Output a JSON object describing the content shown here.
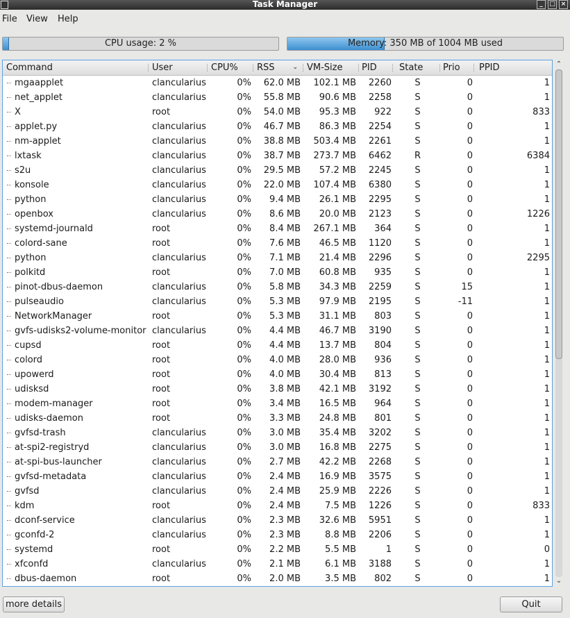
{
  "window": {
    "title": "Task Manager"
  },
  "menu": {
    "file": "File",
    "view": "View",
    "help": "Help"
  },
  "cpu_bar": {
    "label": "CPU usage: 2 %",
    "fraction": 0.02
  },
  "mem_bar": {
    "label": "Memory: 350 MB of 1004 MB used",
    "fraction": 0.349
  },
  "columns": [
    "Command",
    "User",
    "CPU%",
    "RSS",
    "VM-Size",
    "PID",
    "State",
    "Prio",
    "PPID"
  ],
  "sort_indicator": "chevron-down-icon",
  "processes": [
    [
      "mgaapplet",
      "clancularius",
      "0%",
      "62.0 MB",
      "102.1 MB",
      "2260",
      "S",
      "0",
      "1"
    ],
    [
      "net_applet",
      "clancularius",
      "0%",
      "55.8 MB",
      "90.6 MB",
      "2258",
      "S",
      "0",
      "1"
    ],
    [
      "X",
      "root",
      "0%",
      "54.0 MB",
      "95.3 MB",
      "922",
      "S",
      "0",
      "833"
    ],
    [
      "applet.py",
      "clancularius",
      "0%",
      "46.7 MB",
      "86.3 MB",
      "2254",
      "S",
      "0",
      "1"
    ],
    [
      "nm-applet",
      "clancularius",
      "0%",
      "38.8 MB",
      "503.4 MB",
      "2261",
      "S",
      "0",
      "1"
    ],
    [
      "lxtask",
      "clancularius",
      "0%",
      "38.7 MB",
      "273.7 MB",
      "6462",
      "R",
      "0",
      "6384"
    ],
    [
      "s2u",
      "clancularius",
      "0%",
      "29.5 MB",
      "57.2 MB",
      "2245",
      "S",
      "0",
      "1"
    ],
    [
      "konsole",
      "clancularius",
      "0%",
      "22.0 MB",
      "107.4 MB",
      "6380",
      "S",
      "0",
      "1"
    ],
    [
      "python",
      "clancularius",
      "0%",
      "9.4 MB",
      "26.1 MB",
      "2295",
      "S",
      "0",
      "1"
    ],
    [
      "openbox",
      "clancularius",
      "0%",
      "8.6 MB",
      "20.0 MB",
      "2123",
      "S",
      "0",
      "1226"
    ],
    [
      "systemd-journald",
      "root",
      "0%",
      "8.4 MB",
      "267.1 MB",
      "364",
      "S",
      "0",
      "1"
    ],
    [
      "colord-sane",
      "root",
      "0%",
      "7.6 MB",
      "46.5 MB",
      "1120",
      "S",
      "0",
      "1"
    ],
    [
      "python",
      "clancularius",
      "0%",
      "7.1 MB",
      "21.4 MB",
      "2296",
      "S",
      "0",
      "2295"
    ],
    [
      "polkitd",
      "root",
      "0%",
      "7.0 MB",
      "60.8 MB",
      "935",
      "S",
      "0",
      "1"
    ],
    [
      "pinot-dbus-daemon",
      "clancularius",
      "0%",
      "5.8 MB",
      "34.3 MB",
      "2259",
      "S",
      "15",
      "1"
    ],
    [
      "pulseaudio",
      "clancularius",
      "0%",
      "5.3 MB",
      "97.9 MB",
      "2195",
      "S",
      "-11",
      "1"
    ],
    [
      "NetworkManager",
      "root",
      "0%",
      "5.3 MB",
      "31.1 MB",
      "803",
      "S",
      "0",
      "1"
    ],
    [
      "gvfs-udisks2-volume-monitor",
      "clancularius",
      "0%",
      "4.4 MB",
      "46.7 MB",
      "3190",
      "S",
      "0",
      "1"
    ],
    [
      "cupsd",
      "root",
      "0%",
      "4.4 MB",
      "13.7 MB",
      "804",
      "S",
      "0",
      "1"
    ],
    [
      "colord",
      "root",
      "0%",
      "4.0 MB",
      "28.0 MB",
      "936",
      "S",
      "0",
      "1"
    ],
    [
      "upowerd",
      "root",
      "0%",
      "4.0 MB",
      "30.4 MB",
      "813",
      "S",
      "0",
      "1"
    ],
    [
      "udisksd",
      "root",
      "0%",
      "3.8 MB",
      "42.1 MB",
      "3192",
      "S",
      "0",
      "1"
    ],
    [
      "modem-manager",
      "root",
      "0%",
      "3.4 MB",
      "16.5 MB",
      "964",
      "S",
      "0",
      "1"
    ],
    [
      "udisks-daemon",
      "root",
      "0%",
      "3.3 MB",
      "24.8 MB",
      "801",
      "S",
      "0",
      "1"
    ],
    [
      "gvfsd-trash",
      "clancularius",
      "0%",
      "3.0 MB",
      "35.4 MB",
      "3202",
      "S",
      "0",
      "1"
    ],
    [
      "at-spi2-registryd",
      "clancularius",
      "0%",
      "3.0 MB",
      "16.8 MB",
      "2275",
      "S",
      "0",
      "1"
    ],
    [
      "at-spi-bus-launcher",
      "clancularius",
      "0%",
      "2.7 MB",
      "42.2 MB",
      "2268",
      "S",
      "0",
      "1"
    ],
    [
      "gvfsd-metadata",
      "clancularius",
      "0%",
      "2.4 MB",
      "16.9 MB",
      "3575",
      "S",
      "0",
      "1"
    ],
    [
      "gvfsd",
      "clancularius",
      "0%",
      "2.4 MB",
      "25.9 MB",
      "2226",
      "S",
      "0",
      "1"
    ],
    [
      "kdm",
      "root",
      "0%",
      "2.4 MB",
      "7.5 MB",
      "1226",
      "S",
      "0",
      "833"
    ],
    [
      "dconf-service",
      "clancularius",
      "0%",
      "2.3 MB",
      "32.6 MB",
      "5951",
      "S",
      "0",
      "1"
    ],
    [
      "gconfd-2",
      "clancularius",
      "0%",
      "2.3 MB",
      "8.8 MB",
      "2206",
      "S",
      "0",
      "1"
    ],
    [
      "systemd",
      "root",
      "0%",
      "2.2 MB",
      "5.5 MB",
      "1",
      "S",
      "0",
      "0"
    ],
    [
      "xfconfd",
      "clancularius",
      "0%",
      "2.1 MB",
      "6.1 MB",
      "3188",
      "S",
      "0",
      "1"
    ],
    [
      "dbus-daemon",
      "root",
      "0%",
      "2.0 MB",
      "3.5 MB",
      "802",
      "S",
      "0",
      "1"
    ]
  ],
  "scrollbar": {
    "position_fraction": 0.0,
    "visible_fraction": 0.57
  },
  "buttons": {
    "more_details": "more details",
    "quit": "Quit"
  }
}
